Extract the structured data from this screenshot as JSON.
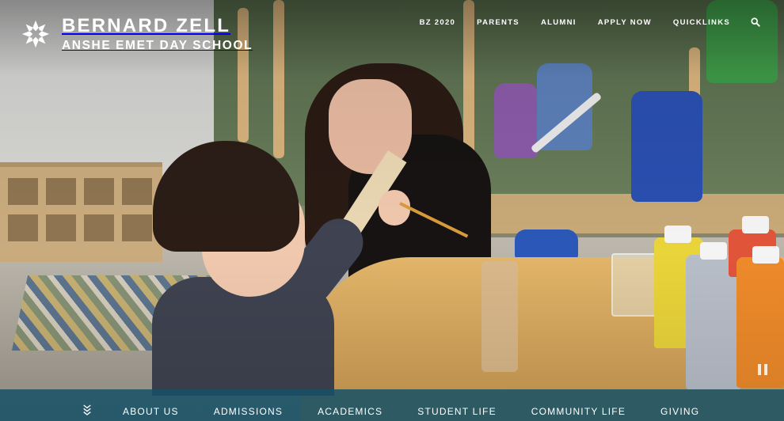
{
  "brand": {
    "name_line1": "BERNARD ZELL",
    "name_line2": "ANSHE EMET DAY SCHOOL",
    "logo_icon": "star-flower-logo"
  },
  "top_nav": {
    "items": [
      "BZ 2020",
      "PARENTS",
      "ALUMNI",
      "APPLY NOW",
      "QUICKLINKS"
    ],
    "search_icon": "search-icon"
  },
  "hero": {
    "media": "classroom photo video background",
    "control_icon": "pause-icon"
  },
  "main_nav": {
    "expand_icon": "double-chevron-down-icon",
    "items": [
      "ABOUT US",
      "ADMISSIONS",
      "ACADEMICS",
      "STUDENT LIFE",
      "COMMUNITY LIFE",
      "GIVING"
    ]
  },
  "colors": {
    "nav_bar": "#165268",
    "text": "#ffffff"
  }
}
